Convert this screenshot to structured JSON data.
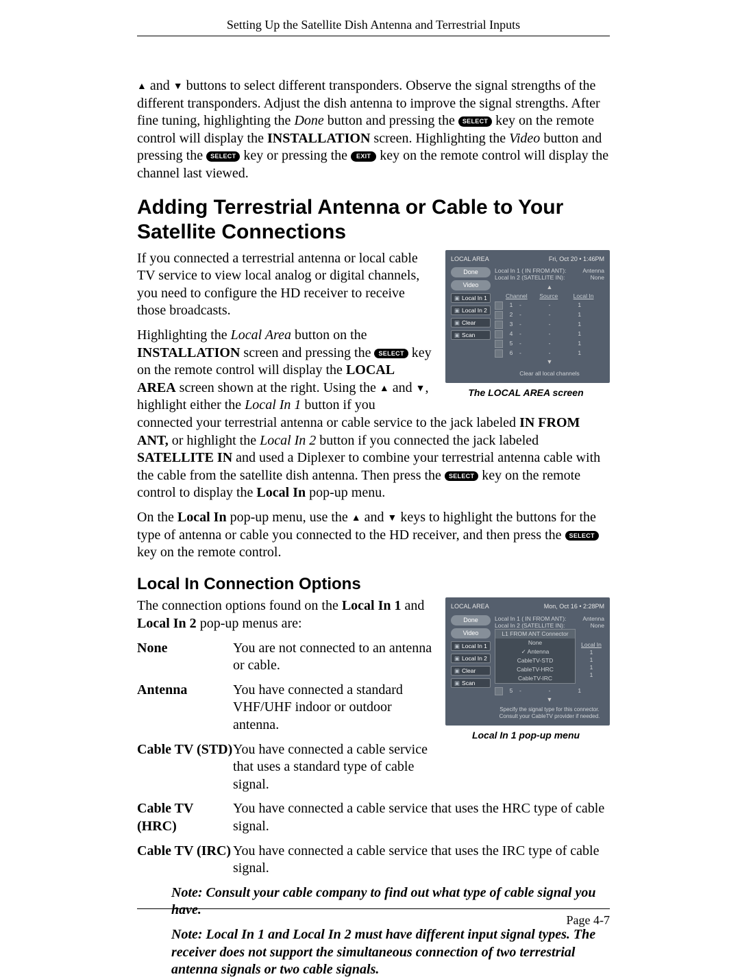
{
  "header": {
    "running": "Setting Up the Satellite Dish Antenna and Terrestrial Inputs"
  },
  "buttons": {
    "select": "SELECT",
    "exit": "EXIT"
  },
  "arrows": {
    "up": "▲",
    "down": "▼"
  },
  "intro": {
    "pre": " and ",
    "post1": " buttons to select different transponders. Observe the signal strengths of the different transponders. Adjust the dish antenna to improve the signal strengths. After fine tuning, highlighting the ",
    "done": "Done",
    "post2": " button and pressing the ",
    "post3": " key on the remote control will display the ",
    "install": "INSTALLATION",
    "post4": " screen. Highlighting the ",
    "video": "Video",
    "post5": " button and pressing the ",
    "post6": " key or pressing the ",
    "post7": " key on the remote control will display the channel last viewed."
  },
  "h1": "Adding Terrestrial Antenna or Cable to Your Satellite Connections",
  "p1": "If you connected a terrestrial antenna or local cable TV service to view local analog or digital channels, you need to configure the HD receiver to receive those broadcasts.",
  "p2": {
    "a": "Highlighting the ",
    "la": "Local Area",
    "b": " button on the ",
    "inst": "INSTALLATION",
    "c": " screen and pressing the ",
    "d": " key on the remote control will display the ",
    "las": "LOCAL AREA",
    "e": " screen shown at the right. Using the ",
    "and": " and ",
    "f": ", highlight either the ",
    "li1": "Local In 1",
    "g": " button if you connected your terrestrial antenna or cable service to the jack labeled ",
    "ant": "IN FROM ANT,",
    "h": " or highlight the ",
    "li2": "Local In 2",
    "i": " button if you connected the jack labeled ",
    "sat": "SATELLITE IN",
    "j": " and used a Diplexer to combine your terrestrial antenna cable with the cable from the satellite dish antenna. Then press the ",
    "k": " key on the remote control to display the ",
    "li": "Local In",
    "l": " pop-up menu."
  },
  "p3": {
    "a": "On the ",
    "li": "Local In",
    "b": " pop-up menu, use the ",
    "and": " and ",
    "c": " keys to highlight the buttons for the type of antenna or cable you connected to the HD receiver, and then press the ",
    "d": " key on the remote control."
  },
  "h2": "Local In Connection Options",
  "p4a": "The connection options found on the ",
  "p4b": "Local In 1",
  "p4c": " and ",
  "p4d": "Local In 2",
  "p4e": " pop-up menus are:",
  "opts": [
    {
      "term": "None",
      "def": "You are not connected to an antenna or cable."
    },
    {
      "term": "Antenna",
      "def": "You have connected a standard VHF/UHF indoor or outdoor antenna."
    },
    {
      "term": "Cable TV (STD)",
      "def": "You have connected a cable service that uses a standard type of cable signal."
    },
    {
      "term": "Cable TV (HRC)",
      "def": "You have connected a cable service that uses the HRC type of cable signal."
    },
    {
      "term": "Cable TV (IRC)",
      "def": "You have connected a cable service that uses the IRC type of cable signal."
    }
  ],
  "note1": "Note: Consult your cable company to find out what type of cable signal you have.",
  "note2": "Note: Local In 1 and Local In 2 must have different input signal types. The receiver does not support the simultaneous connection of two terrestrial antenna signals or two cable signals.",
  "footer": {
    "page": "Page 4-7"
  },
  "fig1": {
    "caption": "The LOCAL AREA screen",
    "title": "LOCAL AREA",
    "date": "Fri, Oct 20 • 1:46PM",
    "sidebar": [
      "Done",
      "Video",
      "Local In 1",
      "Local In 2",
      "Clear",
      "Scan"
    ],
    "info": {
      "l1": "Local In 1 ( IN FROM ANT):",
      "l2": "Local In 2 (SATELLITE IN):",
      "r1": "Antenna",
      "r2": "None"
    },
    "headers": [
      "",
      "Channel",
      "Source",
      "Local In"
    ],
    "rows": [
      [
        "1",
        "-",
        "-",
        "1"
      ],
      [
        "2",
        "-",
        "-",
        "1"
      ],
      [
        "3",
        "-",
        "-",
        "1"
      ],
      [
        "4",
        "-",
        "-",
        "1"
      ],
      [
        "5",
        "-",
        "-",
        "1"
      ],
      [
        "6",
        "-",
        "-",
        "1"
      ]
    ],
    "foot": "Clear all local channels"
  },
  "fig2": {
    "caption": "Local In 1 pop-up menu",
    "title": "LOCAL AREA",
    "date": "Mon, Oct 16 • 2:28PM",
    "sidebar": [
      "Done",
      "Video",
      "Local In 1",
      "Local In 2",
      "Clear",
      "Scan"
    ],
    "info": {
      "l1": "Local In 1 ( IN FROM ANT):",
      "l2": "Local In 2 (SATELLITE IN):",
      "r1": "Antenna",
      "r2": "None"
    },
    "popup": {
      "header": "L1 FROM ANT Connector",
      "options": [
        "None",
        "Antenna",
        "CableTV-STD",
        "CableTV-HRC",
        "CableTV-IRC"
      ],
      "selected": "Antenna",
      "right": "Local In"
    },
    "leftover_row": [
      "5",
      "-",
      "-",
      "1"
    ],
    "hint": "Specify the signal type for this connector.\nConsult your CableTV provider if needed."
  }
}
